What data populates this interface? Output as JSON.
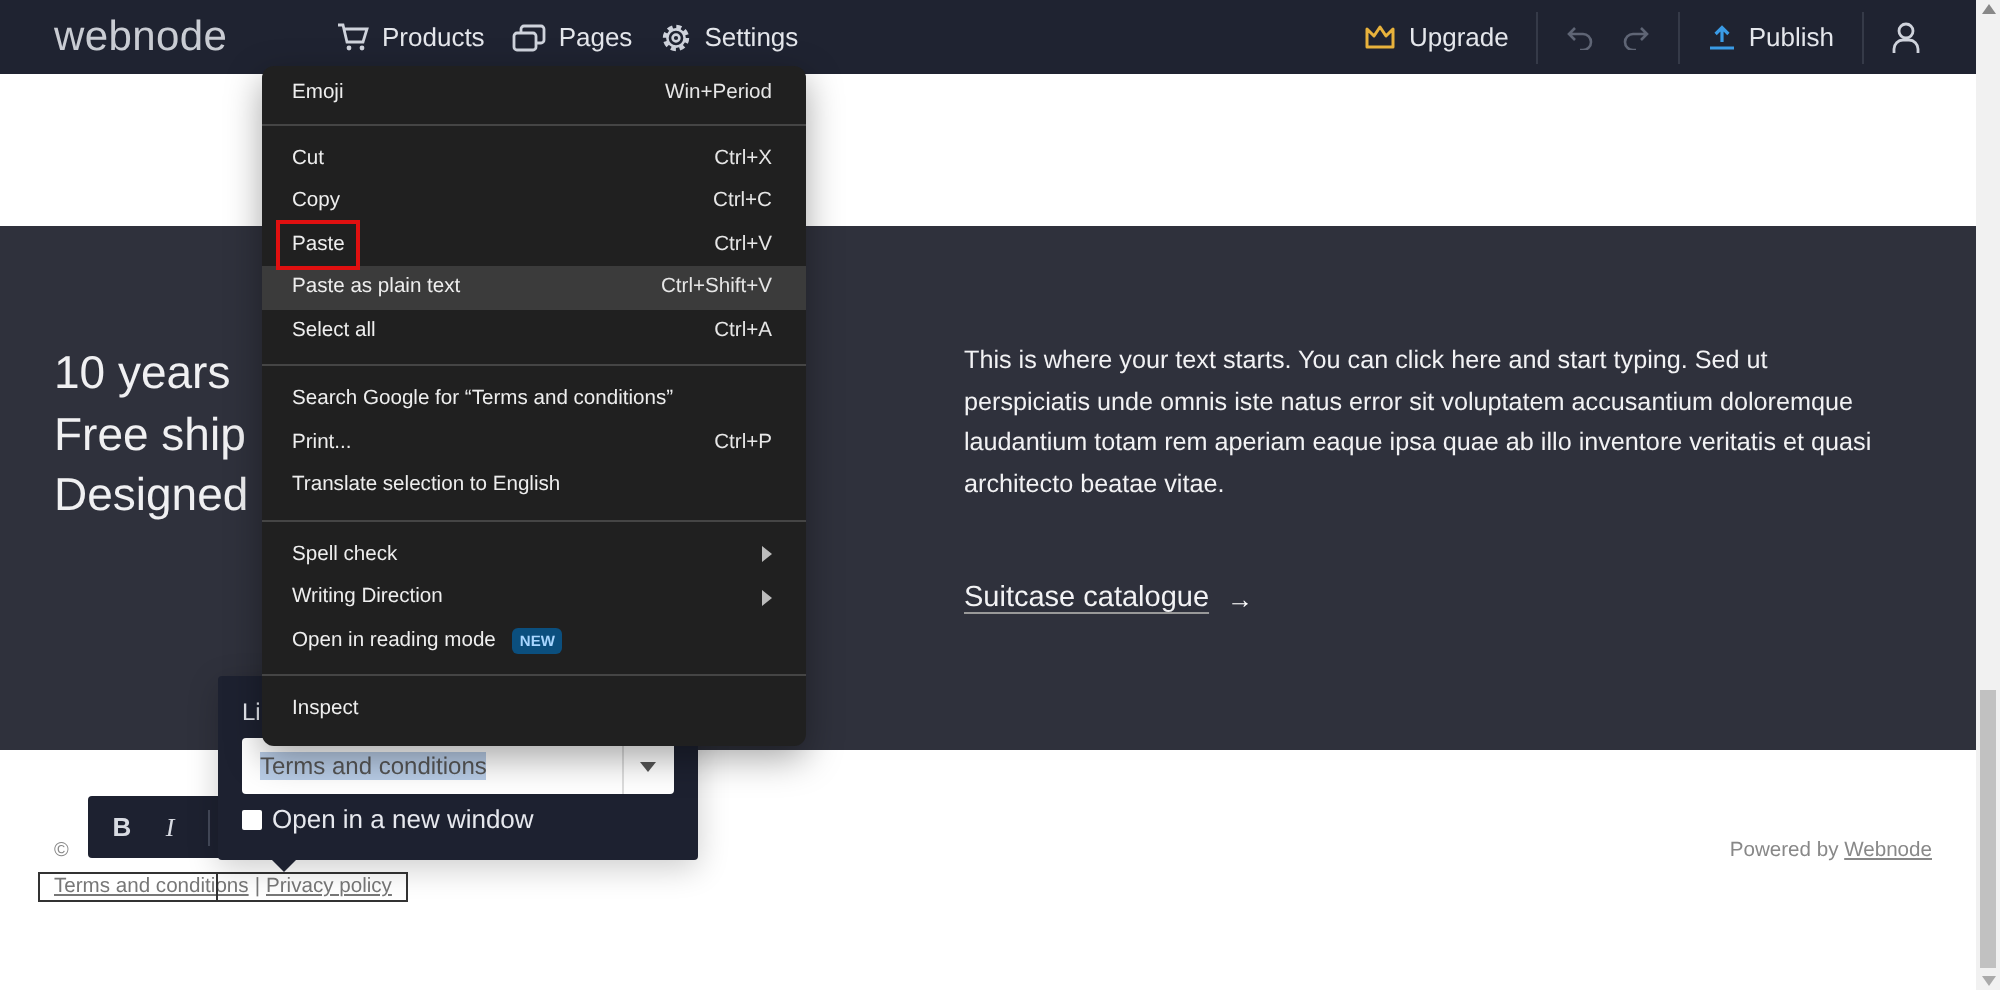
{
  "topbar": {
    "logo": "webnode",
    "nav": [
      {
        "label": "Products"
      },
      {
        "label": "Pages"
      },
      {
        "label": "Settings"
      }
    ],
    "upgrade": "Upgrade",
    "publish": "Publish"
  },
  "feature_lines": [
    "10 years",
    "Free ship",
    "Designed"
  ],
  "text_block": {
    "paragraph": "This is where your text starts. You can click here and start typing. Sed ut perspiciatis unde omnis iste natus error sit voluptatem accusantium doloremque laudantium totam rem aperiam eaque ipsa quae ab illo inventore veritatis et quasi architecto beatae vitae.",
    "link": "Suitcase catalogue",
    "link_arrow": "→"
  },
  "footer": {
    "copyright": "©",
    "links": [
      "Terms and conditions",
      "|",
      "Privacy policy"
    ],
    "powered_by": "Powered by",
    "powered_link": "Webnode"
  },
  "format_toolbar": {
    "buttons": [
      {
        "label": "B",
        "kind": "bold"
      },
      {
        "label": "I",
        "kind": "italic"
      }
    ]
  },
  "link_popup": {
    "label": "Li",
    "value": "Terms and conditions",
    "text_selected": true,
    "new_window": {
      "label": "Open in a new window",
      "checked": false
    }
  },
  "context_menu": {
    "sections": [
      [
        {
          "label": "Emoji",
          "shortcut": "Win+Period",
          "hovered": false,
          "outlined": false
        }
      ],
      [
        {
          "label": "Cut",
          "shortcut": "Ctrl+X",
          "hovered": false,
          "outlined": false
        },
        {
          "label": "Copy",
          "shortcut": "Ctrl+C",
          "hovered": false,
          "outlined": false
        },
        {
          "label": "Paste",
          "shortcut": "Ctrl+V",
          "hovered": false,
          "outlined": true
        },
        {
          "label": "Paste as plain text",
          "shortcut": "Ctrl+Shift+V",
          "hovered": true,
          "outlined": false
        },
        {
          "label": "Select all",
          "shortcut": "Ctrl+A",
          "hovered": false,
          "outlined": false
        }
      ],
      [
        {
          "label": "Search Google for “Terms and conditions”",
          "hovered": false,
          "outlined": false
        },
        {
          "label": "Print...",
          "shortcut": "Ctrl+P",
          "hovered": false,
          "outlined": false
        },
        {
          "label": "Translate selection to English",
          "hovered": false,
          "outlined": false
        }
      ],
      [
        {
          "label": "Spell check",
          "submenu": true,
          "hovered": false,
          "outlined": false
        },
        {
          "label": "Writing Direction",
          "submenu": true,
          "hovered": false,
          "outlined": false
        },
        {
          "label": "Open in reading mode",
          "badge": "NEW",
          "hovered": false,
          "outlined": false
        }
      ],
      [
        {
          "label": "Inspect",
          "hovered": false,
          "outlined": false
        }
      ]
    ]
  }
}
